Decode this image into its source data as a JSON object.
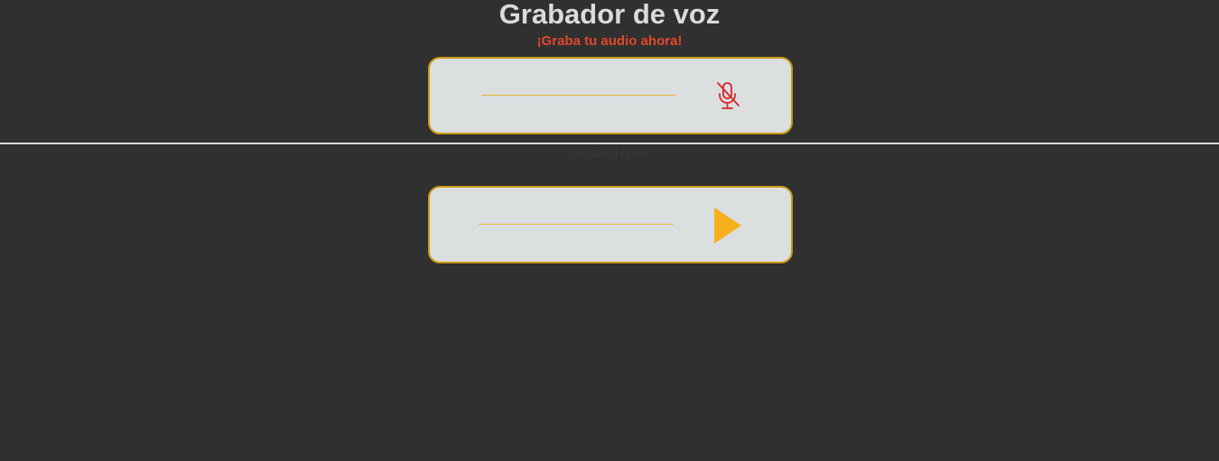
{
  "header": {
    "title": "Grabador de voz",
    "subtitle": "¡Graba tu audio ahora!"
  },
  "recorder": {
    "mic_icon": "microphone-off-icon",
    "mic_state": "muted",
    "mic_color": "#d8262b"
  },
  "status": {
    "text": "00:00:00 / 000"
  },
  "player": {
    "play_icon": "play-icon",
    "play_color": "#f7b01d"
  },
  "colors": {
    "background": "#303030",
    "panel": "#dcdfe0",
    "panel_border": "#c99a14",
    "title": "#d9dcdd",
    "subtitle": "#e3472a",
    "track": "#e8b33a"
  }
}
